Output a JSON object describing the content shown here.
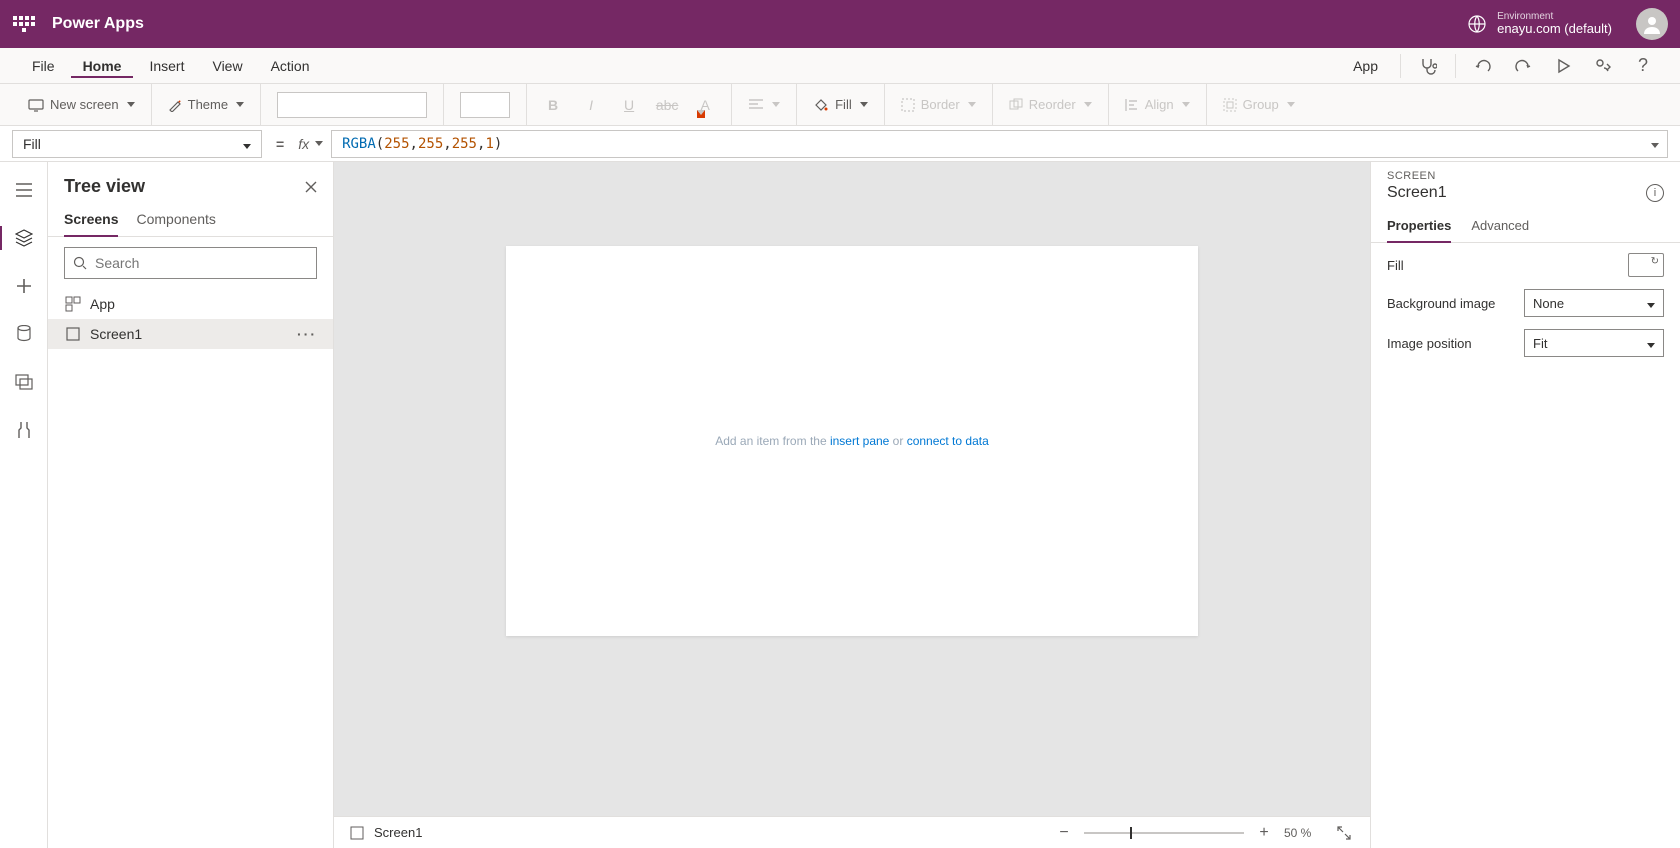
{
  "header": {
    "appTitle": "Power Apps",
    "envLabel": "Environment",
    "envValue": "enayu.com (default)"
  },
  "menu": {
    "items": [
      "File",
      "Home",
      "Insert",
      "View",
      "Action"
    ],
    "activeIndex": 1,
    "appLabel": "App"
  },
  "toolbar": {
    "newScreen": "New screen",
    "theme": "Theme",
    "fill": "Fill",
    "border": "Border",
    "reorder": "Reorder",
    "align": "Align",
    "group": "Group"
  },
  "formula": {
    "property": "Fill",
    "fn": "RGBA",
    "args": [
      "255",
      "255",
      "255",
      "1"
    ]
  },
  "tree": {
    "title": "Tree view",
    "tabs": [
      "Screens",
      "Components"
    ],
    "activeTab": 0,
    "searchPlaceholder": "Search",
    "items": [
      {
        "label": "App",
        "icon": "app",
        "selected": false
      },
      {
        "label": "Screen1",
        "icon": "screen",
        "selected": true
      }
    ]
  },
  "canvas": {
    "hintPrefix": "Add an item from the ",
    "hintLink1": "insert pane",
    "hintMid": " or ",
    "hintLink2": "connect to data"
  },
  "status": {
    "selected": "Screen1",
    "zoom": "50 %"
  },
  "props": {
    "typeLabel": "SCREEN",
    "name": "Screen1",
    "tabs": [
      "Properties",
      "Advanced"
    ],
    "activeTab": 0,
    "rows": {
      "fillLabel": "Fill",
      "bgImageLabel": "Background image",
      "bgImageValue": "None",
      "imgPosLabel": "Image position",
      "imgPosValue": "Fit"
    }
  }
}
